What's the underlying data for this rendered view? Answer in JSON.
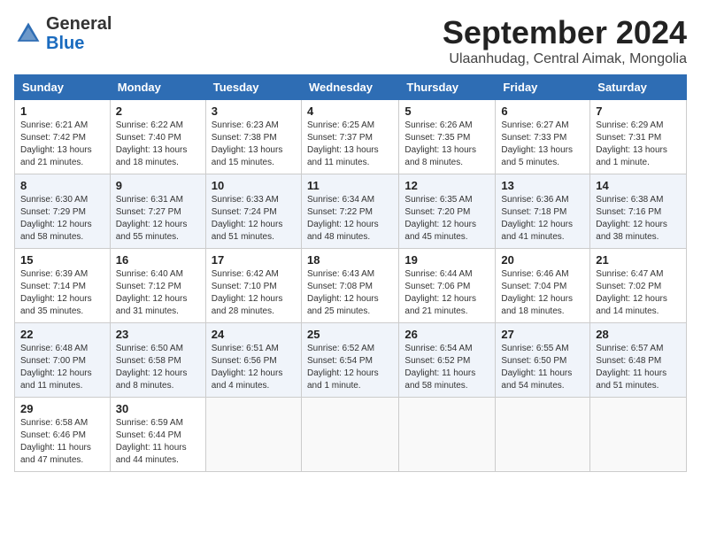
{
  "header": {
    "logo_general": "General",
    "logo_blue": "Blue",
    "month_title": "September 2024",
    "location": "Ulaanhudag, Central Aimak, Mongolia"
  },
  "weekdays": [
    "Sunday",
    "Monday",
    "Tuesday",
    "Wednesday",
    "Thursday",
    "Friday",
    "Saturday"
  ],
  "weeks": [
    [
      {
        "day": "1",
        "info": "Sunrise: 6:21 AM\nSunset: 7:42 PM\nDaylight: 13 hours\nand 21 minutes."
      },
      {
        "day": "2",
        "info": "Sunrise: 6:22 AM\nSunset: 7:40 PM\nDaylight: 13 hours\nand 18 minutes."
      },
      {
        "day": "3",
        "info": "Sunrise: 6:23 AM\nSunset: 7:38 PM\nDaylight: 13 hours\nand 15 minutes."
      },
      {
        "day": "4",
        "info": "Sunrise: 6:25 AM\nSunset: 7:37 PM\nDaylight: 13 hours\nand 11 minutes."
      },
      {
        "day": "5",
        "info": "Sunrise: 6:26 AM\nSunset: 7:35 PM\nDaylight: 13 hours\nand 8 minutes."
      },
      {
        "day": "6",
        "info": "Sunrise: 6:27 AM\nSunset: 7:33 PM\nDaylight: 13 hours\nand 5 minutes."
      },
      {
        "day": "7",
        "info": "Sunrise: 6:29 AM\nSunset: 7:31 PM\nDaylight: 13 hours\nand 1 minute."
      }
    ],
    [
      {
        "day": "8",
        "info": "Sunrise: 6:30 AM\nSunset: 7:29 PM\nDaylight: 12 hours\nand 58 minutes."
      },
      {
        "day": "9",
        "info": "Sunrise: 6:31 AM\nSunset: 7:27 PM\nDaylight: 12 hours\nand 55 minutes."
      },
      {
        "day": "10",
        "info": "Sunrise: 6:33 AM\nSunset: 7:24 PM\nDaylight: 12 hours\nand 51 minutes."
      },
      {
        "day": "11",
        "info": "Sunrise: 6:34 AM\nSunset: 7:22 PM\nDaylight: 12 hours\nand 48 minutes."
      },
      {
        "day": "12",
        "info": "Sunrise: 6:35 AM\nSunset: 7:20 PM\nDaylight: 12 hours\nand 45 minutes."
      },
      {
        "day": "13",
        "info": "Sunrise: 6:36 AM\nSunset: 7:18 PM\nDaylight: 12 hours\nand 41 minutes."
      },
      {
        "day": "14",
        "info": "Sunrise: 6:38 AM\nSunset: 7:16 PM\nDaylight: 12 hours\nand 38 minutes."
      }
    ],
    [
      {
        "day": "15",
        "info": "Sunrise: 6:39 AM\nSunset: 7:14 PM\nDaylight: 12 hours\nand 35 minutes."
      },
      {
        "day": "16",
        "info": "Sunrise: 6:40 AM\nSunset: 7:12 PM\nDaylight: 12 hours\nand 31 minutes."
      },
      {
        "day": "17",
        "info": "Sunrise: 6:42 AM\nSunset: 7:10 PM\nDaylight: 12 hours\nand 28 minutes."
      },
      {
        "day": "18",
        "info": "Sunrise: 6:43 AM\nSunset: 7:08 PM\nDaylight: 12 hours\nand 25 minutes."
      },
      {
        "day": "19",
        "info": "Sunrise: 6:44 AM\nSunset: 7:06 PM\nDaylight: 12 hours\nand 21 minutes."
      },
      {
        "day": "20",
        "info": "Sunrise: 6:46 AM\nSunset: 7:04 PM\nDaylight: 12 hours\nand 18 minutes."
      },
      {
        "day": "21",
        "info": "Sunrise: 6:47 AM\nSunset: 7:02 PM\nDaylight: 12 hours\nand 14 minutes."
      }
    ],
    [
      {
        "day": "22",
        "info": "Sunrise: 6:48 AM\nSunset: 7:00 PM\nDaylight: 12 hours\nand 11 minutes."
      },
      {
        "day": "23",
        "info": "Sunrise: 6:50 AM\nSunset: 6:58 PM\nDaylight: 12 hours\nand 8 minutes."
      },
      {
        "day": "24",
        "info": "Sunrise: 6:51 AM\nSunset: 6:56 PM\nDaylight: 12 hours\nand 4 minutes."
      },
      {
        "day": "25",
        "info": "Sunrise: 6:52 AM\nSunset: 6:54 PM\nDaylight: 12 hours\nand 1 minute."
      },
      {
        "day": "26",
        "info": "Sunrise: 6:54 AM\nSunset: 6:52 PM\nDaylight: 11 hours\nand 58 minutes."
      },
      {
        "day": "27",
        "info": "Sunrise: 6:55 AM\nSunset: 6:50 PM\nDaylight: 11 hours\nand 54 minutes."
      },
      {
        "day": "28",
        "info": "Sunrise: 6:57 AM\nSunset: 6:48 PM\nDaylight: 11 hours\nand 51 minutes."
      }
    ],
    [
      {
        "day": "29",
        "info": "Sunrise: 6:58 AM\nSunset: 6:46 PM\nDaylight: 11 hours\nand 47 minutes."
      },
      {
        "day": "30",
        "info": "Sunrise: 6:59 AM\nSunset: 6:44 PM\nDaylight: 11 hours\nand 44 minutes."
      },
      {
        "day": "",
        "info": ""
      },
      {
        "day": "",
        "info": ""
      },
      {
        "day": "",
        "info": ""
      },
      {
        "day": "",
        "info": ""
      },
      {
        "day": "",
        "info": ""
      }
    ]
  ]
}
